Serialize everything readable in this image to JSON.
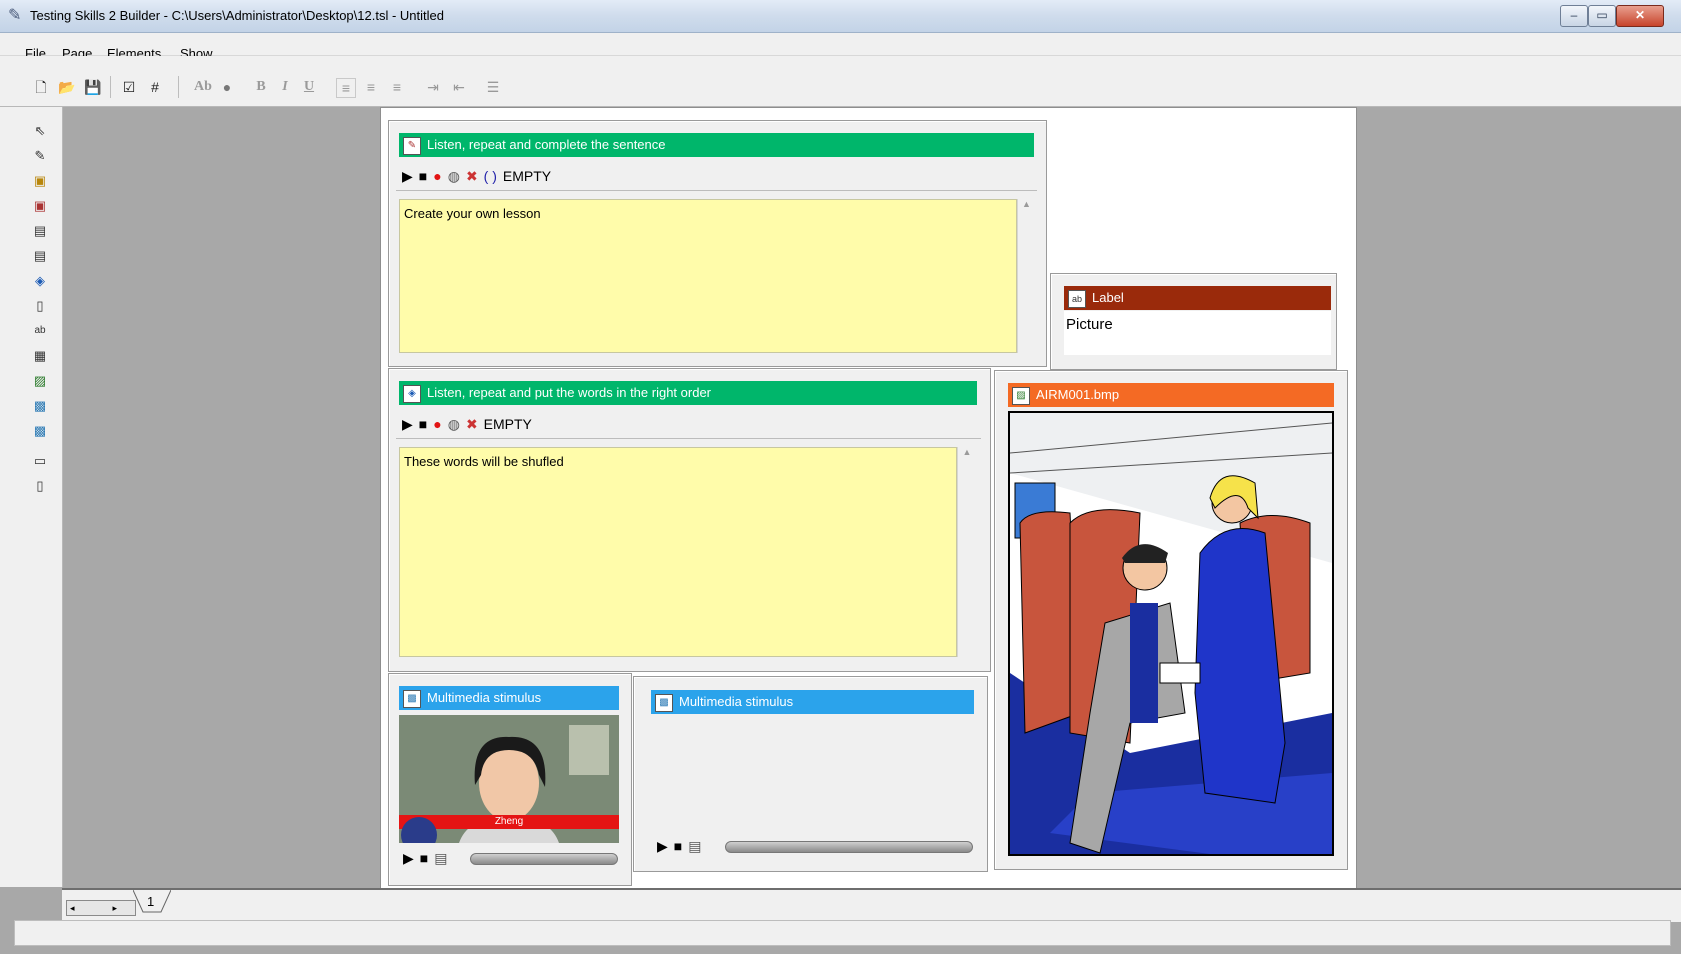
{
  "window": {
    "title": "Testing Skills 2 Builder - C:\\Users\\Administrator\\Desktop\\12.tsl - Untitled",
    "minimize": "‒",
    "maximize": "▭",
    "close": "✕"
  },
  "menu": [
    "File",
    "Page",
    "Elements",
    "Show"
  ],
  "toolbar": {
    "icons": [
      "new-file",
      "open-folder",
      "save",
      "check",
      "grid",
      "spell-check",
      "color",
      "bold",
      "italic",
      "underline",
      "align-left",
      "align-center",
      "align-right",
      "indent",
      "outdent",
      "bullets"
    ],
    "spell_label": "Ab",
    "bold_label": "B",
    "italic_label": "I",
    "underline_label": "U"
  },
  "toolbox": [
    "pointer",
    "listen-complete",
    "question",
    "listen-repeat",
    "list",
    "list-2",
    "order",
    "blank-page",
    "label",
    "text",
    "picture",
    "multimedia",
    "multimedia-2",
    "frame",
    "column"
  ],
  "elements": {
    "complete_sentence": {
      "title": "Listen, repeat and complete the sentence",
      "status": "EMPTY",
      "text": "Create your own lesson"
    },
    "label": {
      "title": "Label",
      "text": "Picture"
    },
    "word_order": {
      "title": "Listen, repeat and put the words in the right order",
      "status": "EMPTY",
      "text": "These words will be shufled"
    },
    "picture": {
      "title": "AIRM001.bmp"
    },
    "multimedia_1": {
      "title": "Multimedia stimulus",
      "caption": "Zheng"
    },
    "multimedia_2": {
      "title": "Multimedia stimulus"
    }
  },
  "tabs": {
    "page_tab": "1"
  },
  "colors": {
    "green_header": "#00b66b",
    "brown_header": "#9a2a0b",
    "orange_header": "#f46a24",
    "blue_header": "#2ba3eb",
    "textarea_bg": "#fffcaa"
  }
}
